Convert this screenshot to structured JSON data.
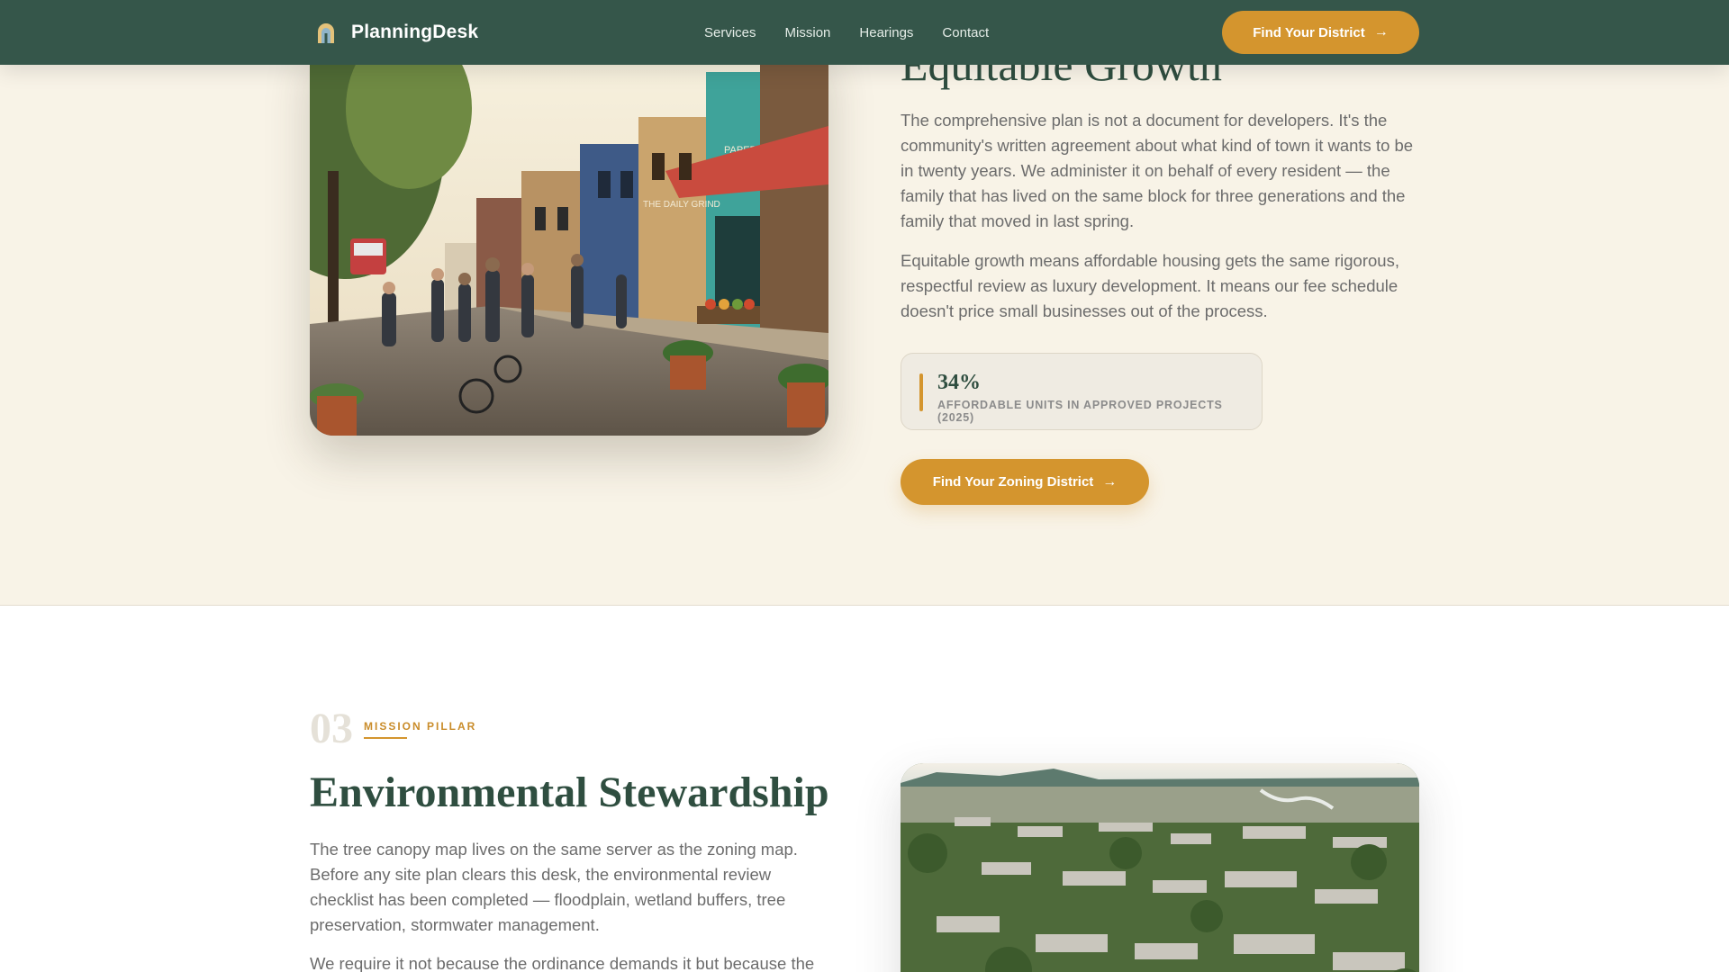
{
  "header": {
    "brand": "PlanningDesk",
    "logo_icon": "arch-icon",
    "nav": [
      "Services",
      "Mission",
      "Hearings",
      "Contact"
    ],
    "cta_label": "Find Your District",
    "cta_icon": "arrow-right-icon"
  },
  "equitable": {
    "title": "Equitable Growth",
    "paragraph_1": "The comprehensive plan is not a document for developers. It's the community's written agreement about what kind of town it wants to be in twenty years. We administer it on behalf of every resident — the family that has lived on the same block for three generations and the family that moved in last spring.",
    "paragraph_2": "Equitable growth means affordable housing gets the same rigorous, respectful review as luxury development. It means our fee schedule doesn't price small businesses out of the process.",
    "stat_value": "34%",
    "stat_label": "AFFORDABLE UNITS IN APPROVED PROJECTS (2025)",
    "cta_label": "Find Your Zoning District",
    "storefront_signs": [
      "THE DAILY GRIND",
      "PAPERBACK PARADISE"
    ]
  },
  "environment": {
    "number": "03",
    "eyebrow": "MISSION PILLAR",
    "title": "Environmental Stewardship",
    "paragraph_1": "The tree canopy map lives on the same server as the zoning map. Before any site plan clears this desk, the environmental review checklist has been completed — floodplain, wetland buffers, tree preservation, stormwater management.",
    "paragraph_2": "We require it not because the ordinance demands it but because the"
  },
  "colors": {
    "header_bg": "#35564a",
    "accent": "#d4952e",
    "heading": "#2f4e40",
    "cream": "#f8f3e7"
  }
}
